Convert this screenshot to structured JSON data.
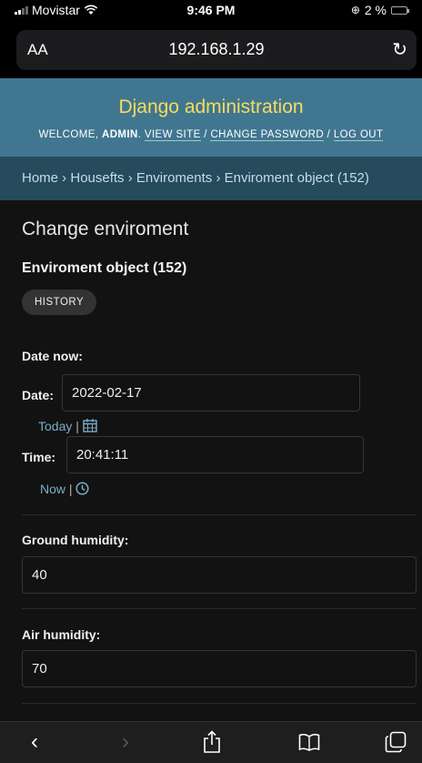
{
  "status": {
    "carrier": "Movistar",
    "time": "9:46 PM",
    "battery": "2 %"
  },
  "browser": {
    "text_size": "AA",
    "url": "192.168.1.29"
  },
  "header": {
    "site_name": "Django administration",
    "welcome": "WELCOME,",
    "username": "ADMIN",
    "view_site": "VIEW SITE",
    "change_password": "CHANGE PASSWORD",
    "log_out": "LOG OUT",
    "sep": " / "
  },
  "breadcrumbs": {
    "home": "Home",
    "app": "Housefts",
    "model": "Enviroments",
    "object": "Enviroment object (152)",
    "sep": " › "
  },
  "page": {
    "title": "Change enviroment",
    "object_title": "Enviroment object (152)",
    "history_label": "HISTORY"
  },
  "form": {
    "date_now": {
      "label": "Date now:",
      "date_label": "Date:",
      "date_value": "2022-02-17",
      "today_link": "Today",
      "time_label": "Time:",
      "time_value": "20:41:11",
      "now_link": "Now",
      "sep": " | "
    },
    "ground_humidity": {
      "label": "Ground humidity:",
      "value": "40"
    },
    "air_humidity": {
      "label": "Air humidity:",
      "value": "70"
    }
  },
  "colors": {
    "header_bg": "#417690",
    "site_name": "#f5dd5d",
    "breadcrumbs_bg": "#264b5d",
    "link": "#79aec8",
    "body_bg": "#121212"
  }
}
